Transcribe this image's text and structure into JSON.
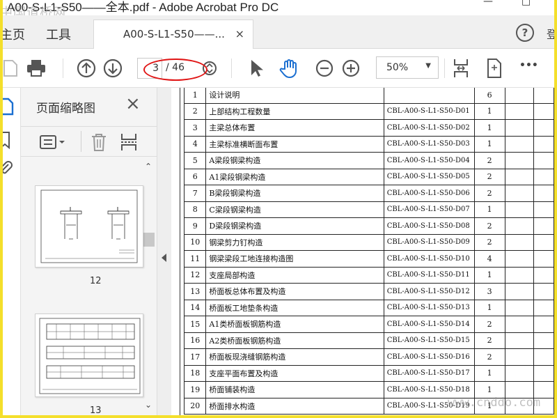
{
  "window": {
    "title": "A00-S-L1-S50——全本.pdf - Adobe Acrobat Pro DC",
    "watermark_top": "中国道桥网"
  },
  "tabs": {
    "home_label": "主页",
    "tools_label": "工具",
    "document_tab_label": "A00-S-L1-S50——...",
    "close_glyph": "×",
    "help_glyph": "?"
  },
  "toolbar": {
    "current_page": "3",
    "total_pages": "/ 46",
    "zoom_value": "50%",
    "more_glyph": "•••"
  },
  "thumbnail_panel": {
    "title": "页面缩略图",
    "close_glyph": "×",
    "thumbnails": [
      {
        "label": "12"
      },
      {
        "label": "13"
      }
    ]
  },
  "document": {
    "rows": [
      {
        "no": "1",
        "name": "设计说明",
        "code": "",
        "count": "6"
      },
      {
        "no": "2",
        "name": "上部结构工程数量",
        "code": "CBL-A00-S-L1-S50-D01",
        "count": "1"
      },
      {
        "no": "3",
        "name": "主梁总体布置",
        "code": "CBL-A00-S-L1-S50-D02",
        "count": "1"
      },
      {
        "no": "4",
        "name": "主梁标准横断面布置",
        "code": "CBL-A00-S-L1-S50-D03",
        "count": "1"
      },
      {
        "no": "5",
        "name": "A梁段钢梁构造",
        "code": "CBL-A00-S-L1-S50-D04",
        "count": "2"
      },
      {
        "no": "6",
        "name": "A1梁段钢梁构造",
        "code": "CBL-A00-S-L1-S50-D05",
        "count": "2"
      },
      {
        "no": "7",
        "name": "B梁段钢梁构造",
        "code": "CBL-A00-S-L1-S50-D06",
        "count": "2"
      },
      {
        "no": "8",
        "name": "C梁段钢梁构造",
        "code": "CBL-A00-S-L1-S50-D07",
        "count": "1"
      },
      {
        "no": "9",
        "name": "D梁段钢梁构造",
        "code": "CBL-A00-S-L1-S50-D08",
        "count": "2"
      },
      {
        "no": "10",
        "name": "钢梁剪力钉构造",
        "code": "CBL-A00-S-L1-S50-D09",
        "count": "2"
      },
      {
        "no": "11",
        "name": "钢梁梁段工地连接构造图",
        "code": "CBL-A00-S-L1-S50-D10",
        "count": "4"
      },
      {
        "no": "12",
        "name": "支座局部构造",
        "code": "CBL-A00-S-L1-S50-D11",
        "count": "1"
      },
      {
        "no": "13",
        "name": "桥面板总体布置及构造",
        "code": "CBL-A00-S-L1-S50-D12",
        "count": "3"
      },
      {
        "no": "14",
        "name": "桥面板工地垫条构造",
        "code": "CBL-A00-S-L1-S50-D13",
        "count": "1"
      },
      {
        "no": "15",
        "name": "A1类桥面板钢筋构造",
        "code": "CBL-A00-S-L1-S50-D14",
        "count": "2"
      },
      {
        "no": "16",
        "name": "A2类桥面板钢筋构造",
        "code": "CBL-A00-S-L1-S50-D15",
        "count": "2"
      },
      {
        "no": "17",
        "name": "桥面板现浇缝钢筋构造",
        "code": "CBL-A00-S-L1-S50-D16",
        "count": "2"
      },
      {
        "no": "18",
        "name": "支座平面布置及构造",
        "code": "CBL-A00-S-L1-S50-D17",
        "count": "1"
      },
      {
        "no": "19",
        "name": "桥面铺装构造",
        "code": "CBL-A00-S-L1-S50-D18",
        "count": "1"
      },
      {
        "no": "20",
        "name": "桥面排水构造",
        "code": "CBL-A00-S-L1-S50-D19",
        "count": "1"
      }
    ],
    "watermark_bottom": "www.cnddo.com"
  },
  "colors": {
    "outer_border": "#f4df2b",
    "annotation_red": "#e01414",
    "icon_gray": "#555555"
  }
}
